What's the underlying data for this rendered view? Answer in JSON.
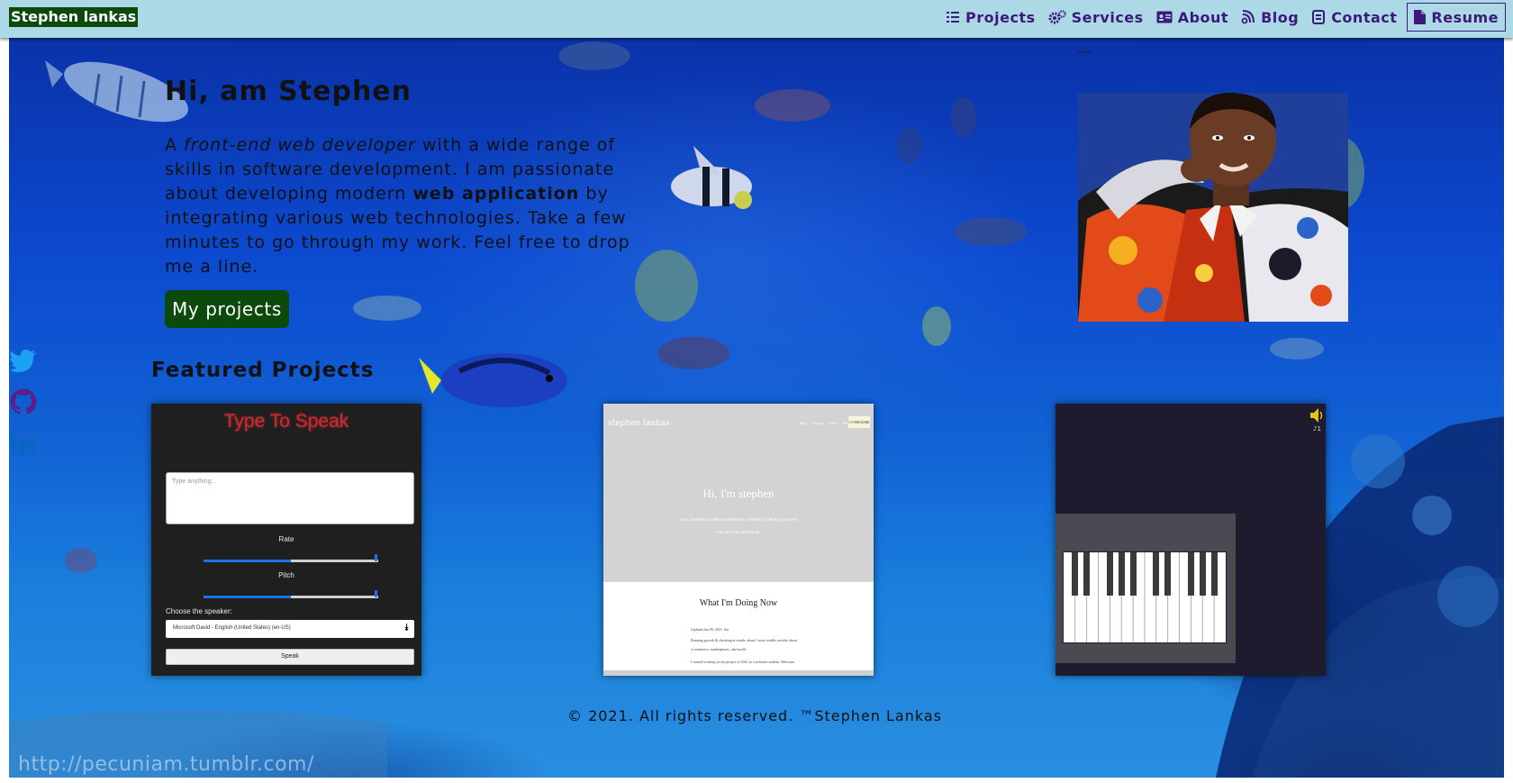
{
  "nav": {
    "brand": "Stephen lankas",
    "links": [
      {
        "label": "Projects",
        "icon": "tasks-icon"
      },
      {
        "label": "Services",
        "icon": "cogs-icon"
      },
      {
        "label": "About",
        "icon": "id-card-icon"
      },
      {
        "label": "Blog",
        "icon": "blog-icon"
      },
      {
        "label": "Contact",
        "icon": "contact-icon"
      },
      {
        "label": "Resume",
        "icon": "file-icon"
      }
    ],
    "colors": {
      "bar": "#add8e6",
      "brand_bg": "#0b4a0b",
      "link": "#3a1a7a"
    }
  },
  "hero": {
    "title": "Hi, am Stephen",
    "text": {
      "prefix": "A ",
      "role": "front-end web developer",
      "middle": " with a wide range of skills in software development. I am passionate about developing modern ",
      "emphasis": "web application",
      "suffix": " by integrating various web technologies. Take a few minutes to go through my work. Feel free to drop me a line."
    },
    "cta_label": "My projects",
    "cta_color": "#0b4a0b"
  },
  "social": [
    {
      "name": "twitter-icon",
      "color": "#1da1f2"
    },
    {
      "name": "github-icon",
      "color": "#5b1f8a"
    },
    {
      "name": "linkedin-icon",
      "color": "#0a66c2"
    }
  ],
  "featured": {
    "title": "Featured Projects",
    "cards": {
      "type_to_speak": {
        "title": "Type To Speak",
        "placeholder": "Type anything...",
        "rate_label": "Rate",
        "pitch_label": "Pitch",
        "rate_value": 0.5,
        "pitch_value": 0.5,
        "speaker_label": "Choose the speaker:",
        "speaker_value": "Microsoft David - English (United States) (en-US)",
        "speak_label": "Speak"
      },
      "portfolio": {
        "brand": "stephen lankas",
        "nav": [
          "Blog",
          "Projects",
          "Links",
          "About Me"
        ],
        "resume": "CV/RESUME",
        "hello": "Hi, I'm stephen",
        "sub": "I am currently a software developer, currently in diving for more web services technology",
        "section_title": "What I'm Doing Now",
        "updated": "Updated Jan 09, 2021. Sat",
        "line1": "Running growth & checking at trends: about I write weekly articles about",
        "line2": "e-commerce, marketplaces, and world",
        "line3": "I started working on the project of 2021 as a software student. Welcome."
      },
      "piano": {
        "volume_label": "🔊",
        "small_label": "♪1"
      }
    }
  },
  "footer": "© 2021. All rights reserved. ™Stephen Lankas",
  "watermark": "http://pecuniam.tumblr.com/"
}
